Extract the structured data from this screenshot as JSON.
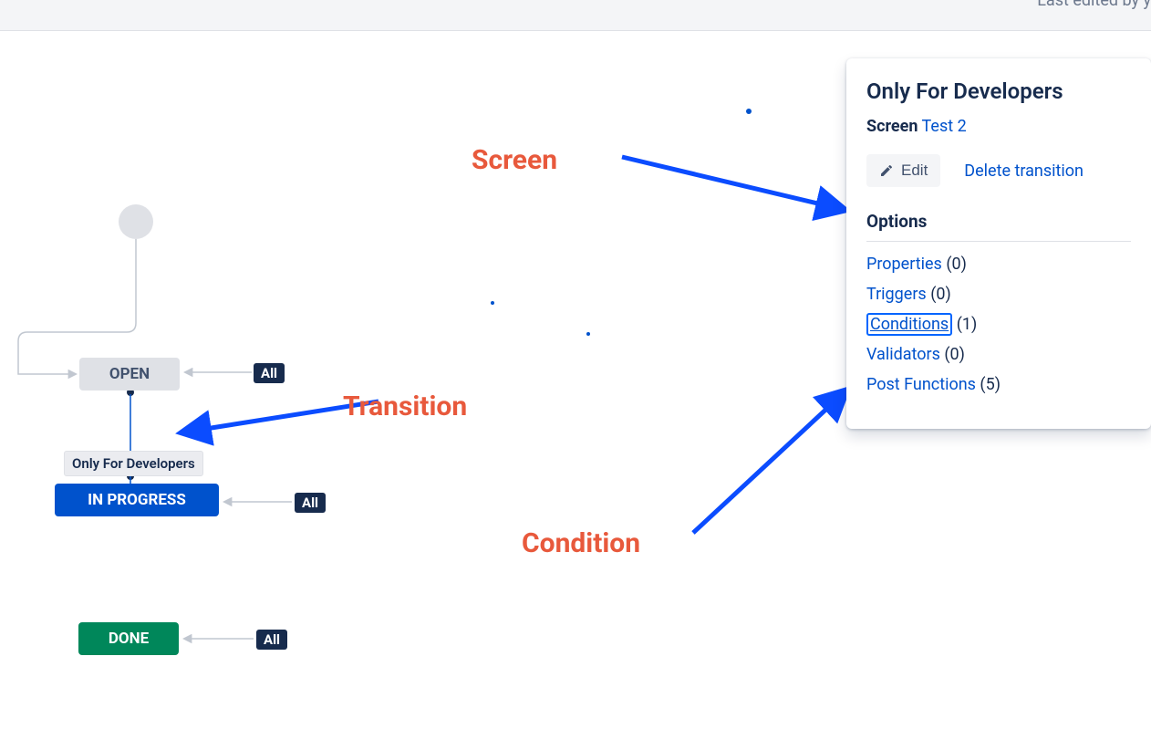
{
  "topbar": {
    "edited_text": "Last edited by y"
  },
  "workflow": {
    "status_open": "OPEN",
    "status_progress": "IN PROGRESS",
    "status_done": "DONE",
    "transition_name": "Only For Developers",
    "all_label": "All"
  },
  "panel": {
    "title": "Only For Developers",
    "screen_label": "Screen",
    "screen_link": "Test 2",
    "edit_label": "Edit",
    "delete_label": "Delete transition",
    "options_header": "Options",
    "options": [
      {
        "label": "Properties",
        "count": "(0)"
      },
      {
        "label": "Triggers",
        "count": "(0)"
      },
      {
        "label": "Conditions",
        "count": "(1)"
      },
      {
        "label": "Validators",
        "count": "(0)"
      },
      {
        "label": "Post Functions",
        "count": "(5)"
      }
    ]
  },
  "annotations": {
    "screen": "Screen",
    "transition": "Transition",
    "condition": "Condition"
  }
}
